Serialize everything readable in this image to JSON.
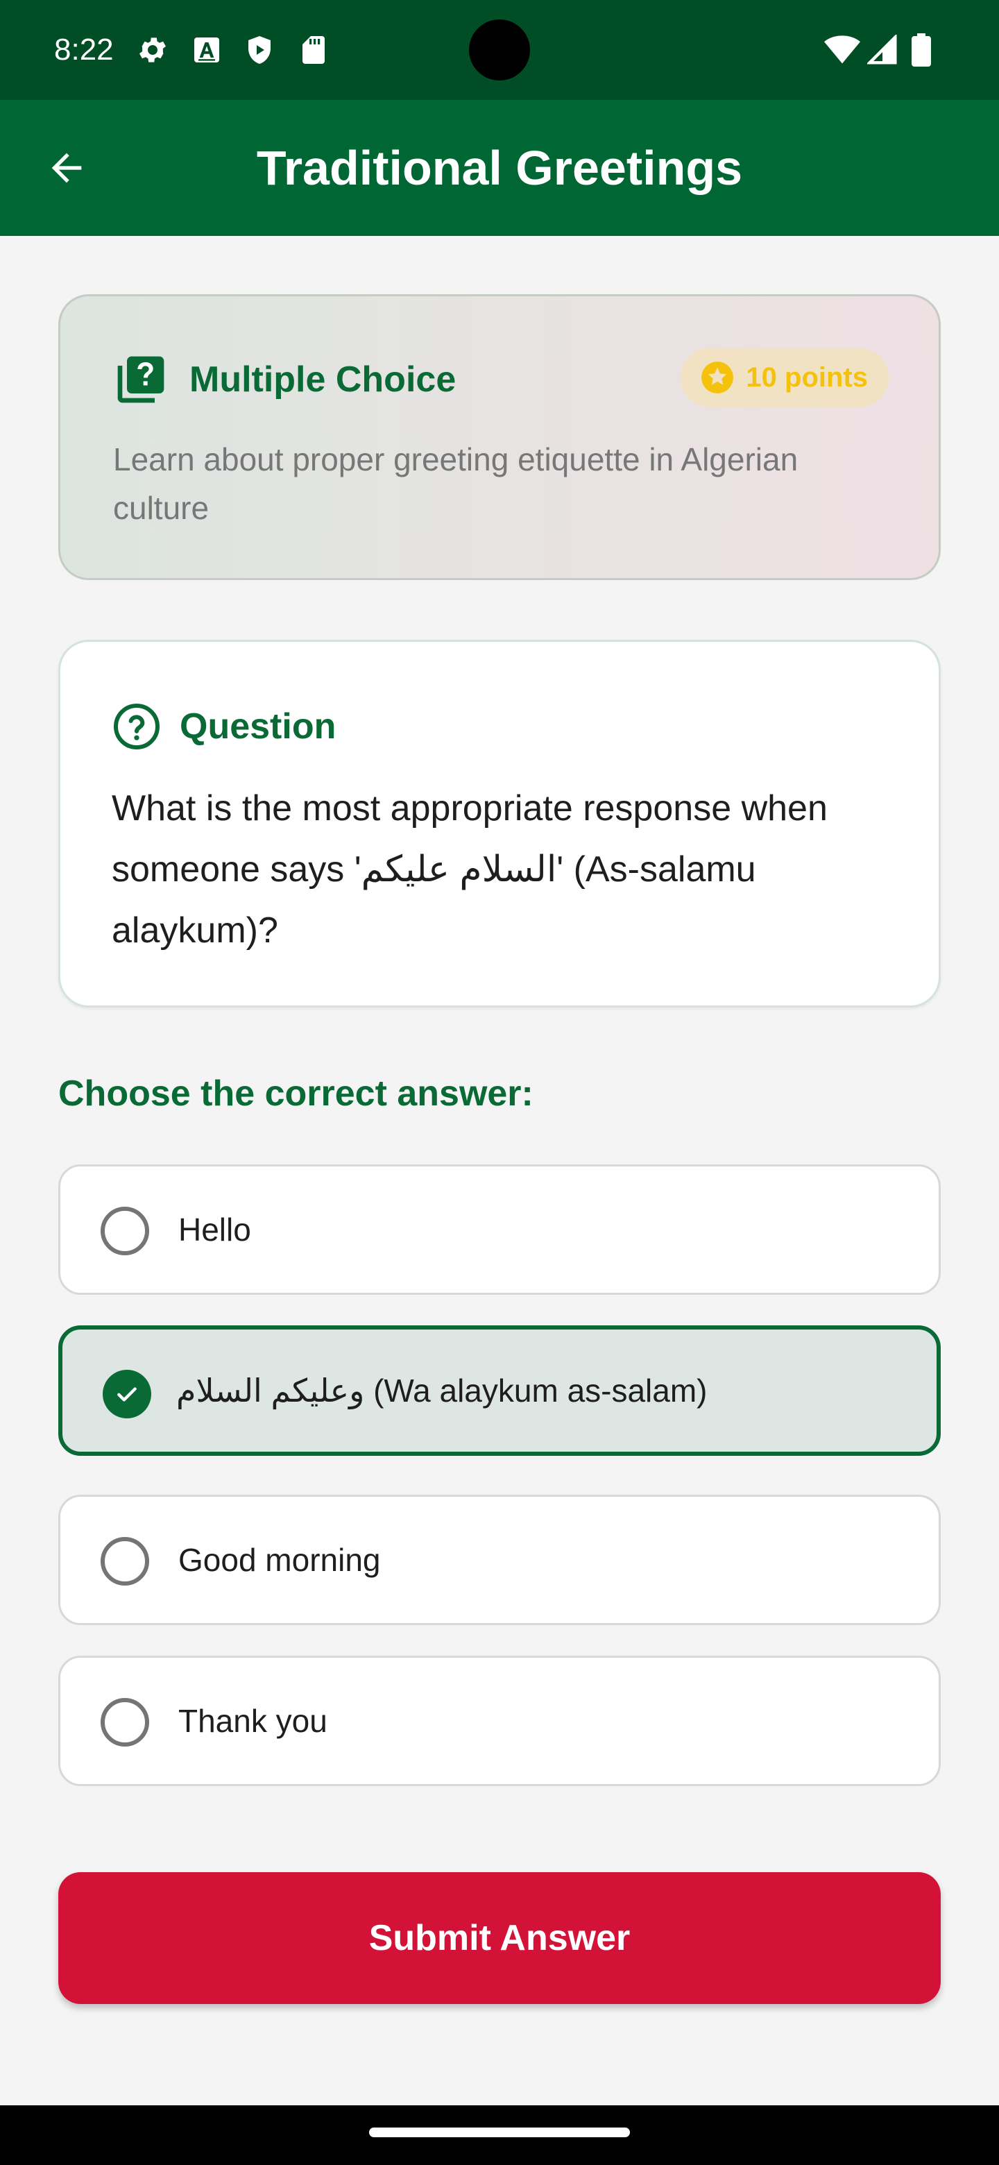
{
  "status_bar": {
    "time": "8:22",
    "left_icons": [
      "gear-icon",
      "font-a-icon",
      "shield-play-icon",
      "sd-card-icon"
    ],
    "right_icons": [
      "wifi-icon",
      "cellular-signal-icon",
      "battery-icon"
    ]
  },
  "app_bar": {
    "title": "Traditional Greetings",
    "back_icon": "arrow-left-icon"
  },
  "info_card": {
    "type_label": "Multiple Choice",
    "points_label": "10 points",
    "description": "Learn about proper greeting etiquette in Algerian culture"
  },
  "question_card": {
    "heading": "Question",
    "text": "What is the most appropriate response when someone says 'السلام عليكم' (As-salamu alaykum)?"
  },
  "choose_label": "Choose the correct answer:",
  "options": [
    {
      "label": "Hello",
      "selected": false
    },
    {
      "label": "وعليكم السلام (Wa alaykum as-salam)",
      "selected": true
    },
    {
      "label": "Good morning",
      "selected": false
    },
    {
      "label": "Thank you",
      "selected": false
    }
  ],
  "submit_label": "Submit Answer",
  "colors": {
    "status_bar": "#004d26",
    "app_bar": "#006633",
    "primary_green": "#0a6a36",
    "submit_red": "#d31238",
    "points_yellow": "#f4c20d"
  }
}
